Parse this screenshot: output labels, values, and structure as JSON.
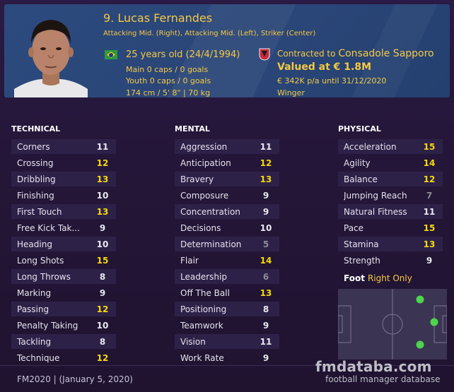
{
  "player": {
    "name": "9. Lucas Fernandes",
    "positions": "Attacking Mid. (Right), Attacking Mid. (Left), Striker (Center)",
    "age": "25 years old (24/4/1994)",
    "main_caps": "Main 0 caps / 0 goals",
    "youth_caps": "Youth 0 caps / 0 goals",
    "height_weight": "174 cm / 5' 8\" | 70 kg",
    "contract_prefix": "Contracted to",
    "club": "Consadole Sapporo",
    "value": "Valued at € 1.8M",
    "wage": "€ 342K p/a until 31/12/2020",
    "role": "Winger"
  },
  "columns": {
    "technical_title": "TECHNICAL",
    "mental_title": "MENTAL",
    "physical_title": "PHYSICAL"
  },
  "technical": [
    {
      "name": "Corners",
      "value": "11"
    },
    {
      "name": "Crossing",
      "value": "12"
    },
    {
      "name": "Dribbling",
      "value": "13"
    },
    {
      "name": "Finishing",
      "value": "10"
    },
    {
      "name": "First Touch",
      "value": "13"
    },
    {
      "name": "Free Kick Tak...",
      "value": "9"
    },
    {
      "name": "Heading",
      "value": "10"
    },
    {
      "name": "Long Shots",
      "value": "15"
    },
    {
      "name": "Long Throws",
      "value": "8"
    },
    {
      "name": "Marking",
      "value": "9"
    },
    {
      "name": "Passing",
      "value": "12"
    },
    {
      "name": "Penalty Taking",
      "value": "10"
    },
    {
      "name": "Tackling",
      "value": "8"
    },
    {
      "name": "Technique",
      "value": "12"
    }
  ],
  "mental": [
    {
      "name": "Aggression",
      "value": "11"
    },
    {
      "name": "Anticipation",
      "value": "12"
    },
    {
      "name": "Bravery",
      "value": "13"
    },
    {
      "name": "Composure",
      "value": "9"
    },
    {
      "name": "Concentration",
      "value": "9"
    },
    {
      "name": "Decisions",
      "value": "10"
    },
    {
      "name": "Determination",
      "value": "5"
    },
    {
      "name": "Flair",
      "value": "14"
    },
    {
      "name": "Leadership",
      "value": "6"
    },
    {
      "name": "Off The Ball",
      "value": "13"
    },
    {
      "name": "Positioning",
      "value": "8"
    },
    {
      "name": "Teamwork",
      "value": "9"
    },
    {
      "name": "Vision",
      "value": "11"
    },
    {
      "name": "Work Rate",
      "value": "9"
    }
  ],
  "physical": [
    {
      "name": "Acceleration",
      "value": "15"
    },
    {
      "name": "Agility",
      "value": "14"
    },
    {
      "name": "Balance",
      "value": "12"
    },
    {
      "name": "Jumping Reach",
      "value": "7"
    },
    {
      "name": "Natural Fitness",
      "value": "11"
    },
    {
      "name": "Pace",
      "value": "15"
    },
    {
      "name": "Stamina",
      "value": "13"
    },
    {
      "name": "Strength",
      "value": "9"
    }
  ],
  "foot": {
    "label": "Foot",
    "value": "Right Only"
  },
  "colors": {
    "low": "#8c8c98",
    "mid": "#e8e8ee",
    "good": "#f5d90a",
    "accent": "#f5c842",
    "pitch_dot": "#4cd44c"
  },
  "footer": {
    "version": "FM2020 | (January 5, 2020)",
    "brand": "fmdataba.com",
    "brand_sub": "football manager database"
  }
}
